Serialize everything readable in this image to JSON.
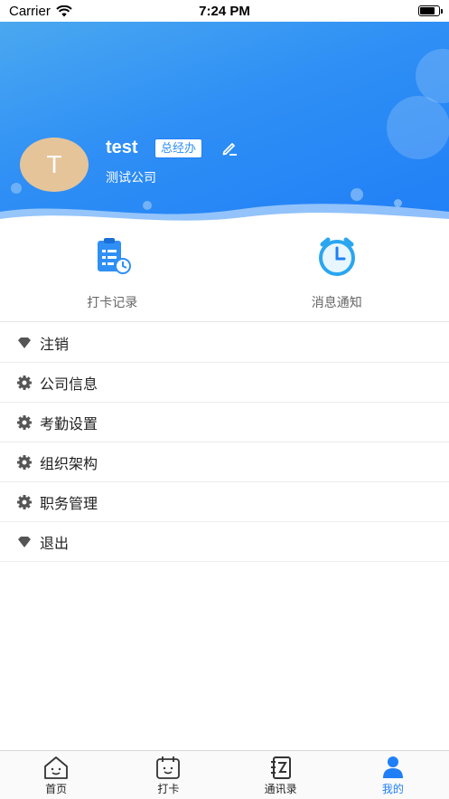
{
  "status_bar": {
    "carrier": "Carrier",
    "time": "7:24 PM"
  },
  "profile": {
    "avatar_letter": "T",
    "name": "test",
    "role": "总经办",
    "company": "测试公司"
  },
  "quick_actions": [
    {
      "label": "打卡记录",
      "icon": "clipboard-clock-icon"
    },
    {
      "label": "消息通知",
      "icon": "alarm-clock-icon"
    }
  ],
  "menu": [
    {
      "label": "注销",
      "icon": "diamond-icon"
    },
    {
      "label": "公司信息",
      "icon": "gear-icon"
    },
    {
      "label": "考勤设置",
      "icon": "gear-icon"
    },
    {
      "label": "组织架构",
      "icon": "gear-icon"
    },
    {
      "label": "职务管理",
      "icon": "gear-icon"
    },
    {
      "label": "退出",
      "icon": "diamond-icon"
    }
  ],
  "tabs": [
    {
      "label": "首页",
      "icon": "home-icon"
    },
    {
      "label": "打卡",
      "icon": "calendar-icon"
    },
    {
      "label": "通讯录",
      "icon": "contacts-icon"
    },
    {
      "label": "我的",
      "icon": "person-icon",
      "active": true
    }
  ],
  "colors": {
    "primary": "#1f7ff6",
    "header_light": "#4aa8f0",
    "avatar": "#e5c49a"
  }
}
